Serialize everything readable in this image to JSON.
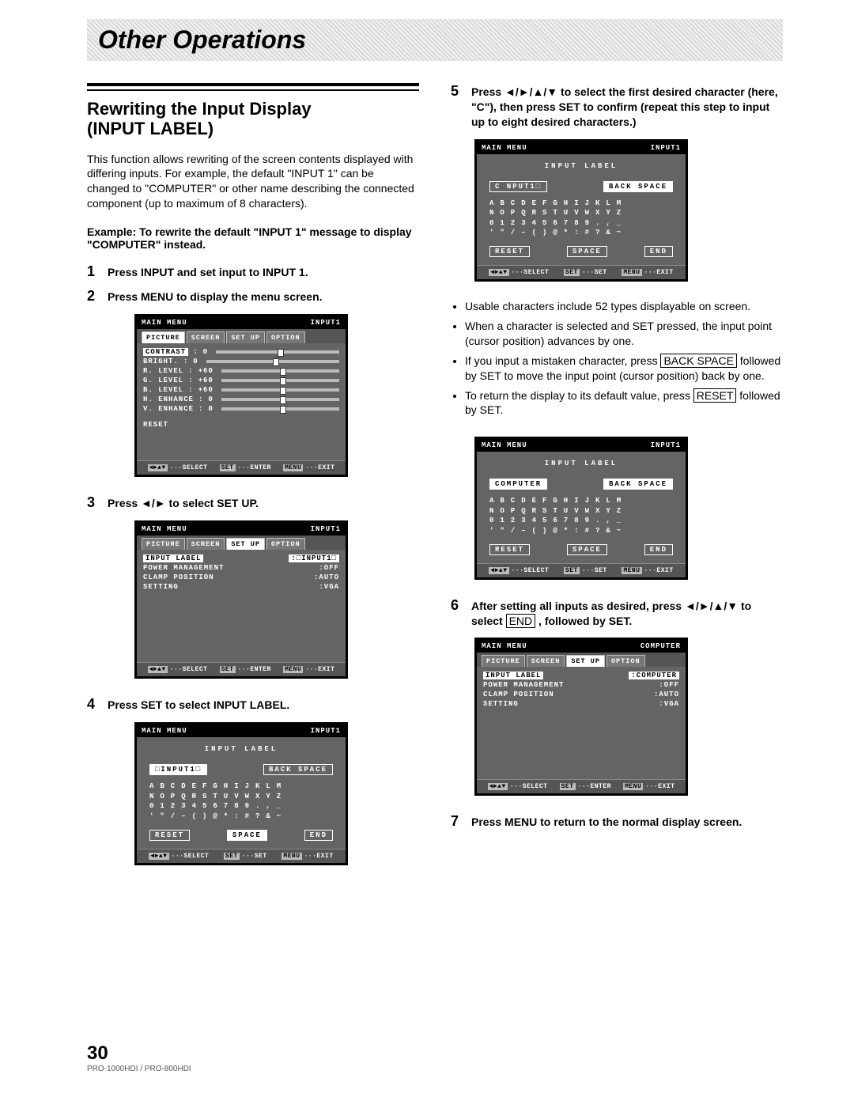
{
  "header": {
    "title": "Other Operations"
  },
  "glyphs": {
    "left": "◄",
    "right": "►",
    "up": "▲",
    "down": "▼"
  },
  "left": {
    "section_title_1": "Rewriting the Input Display",
    "section_title_2": "(INPUT LABEL)",
    "intro": "This function allows rewriting of the screen contents displayed with differing inputs. For example, the default \"INPUT 1\" can be changed to \"COMPUTER\" or other name describing the connected component (up to maximum of 8 characters).",
    "example": "Example: To rewrite the default \"INPUT 1\" message to display \"COMPUTER\" instead.",
    "steps": [
      {
        "num": "1",
        "text": "Press INPUT and set input to INPUT 1."
      },
      {
        "num": "2",
        "text": "Press MENU to display the menu screen."
      },
      {
        "num": "3",
        "pre": "Press ",
        "post": " to select SET UP."
      },
      {
        "num": "4",
        "text": "Press SET to select INPUT LABEL."
      }
    ]
  },
  "right": {
    "steps": [
      {
        "num": "5",
        "pre": "Press ",
        "post": " to select the first desired character (here, \"C\"), then press SET to confirm (repeat this step to input up to eight desired characters.)"
      },
      {
        "num": "6",
        "pre": "After setting all inputs as desired, press ",
        "mid": " to select ",
        "box": "END",
        "post": " , followed by SET."
      },
      {
        "num": "7",
        "text": "Press MENU to return to the normal display screen."
      }
    ],
    "notes": [
      "Usable characters include 52 types displayable on screen.",
      "When a character is selected and SET pressed, the input point (cursor position) advances by one.",
      {
        "pre": "If you input a mistaken character, press ",
        "box": "BACK SPACE",
        "post": " followed by SET to move the input point (cursor position) back by one."
      },
      {
        "pre": "To return the display to its default value, press ",
        "box": "RESET",
        "post": " followed by SET."
      }
    ]
  },
  "shots": {
    "tabs": [
      "PICTURE",
      "SCREEN",
      "SET UP",
      "OPTION"
    ],
    "foot": {
      "select": "···SELECT",
      "set": "SET",
      "enter": "···ENTER",
      "set2": "···SET",
      "menu": "MENU",
      "exit": "···EXIT"
    },
    "btns": {
      "backspace": "BACK SPACE",
      "reset": "RESET",
      "space": "SPACE",
      "end": "END"
    },
    "chars": [
      "ABCDEFGHIJKLM",
      "NOPQRSTUVWXYZ",
      "0123456789.,_",
      "'\"/–()@*:#?&~"
    ],
    "s1": {
      "title": "MAIN MENU",
      "input": "INPUT1",
      "items": [
        {
          "label": "CONTRAST",
          "val": "0"
        },
        {
          "label": "BRIGHT.",
          "val": "0"
        },
        {
          "label": "R. LEVEL",
          "val": "+60"
        },
        {
          "label": "G. LEVEL",
          "val": "+60"
        },
        {
          "label": "B. LEVEL",
          "val": "+60"
        },
        {
          "label": "H. ENHANCE",
          "val": "0"
        },
        {
          "label": "V. ENHANCE",
          "val": "0"
        }
      ],
      "reset": "RESET"
    },
    "s2": {
      "items": [
        {
          "label": "INPUT LABEL",
          "val": ":□INPUT1□"
        },
        {
          "label": "POWER MANAGEMENT",
          "val": ":OFF"
        },
        {
          "label": "CLAMP POSITION",
          "val": ":AUTO"
        },
        {
          "label": "SETTING",
          "val": ":VGA"
        }
      ]
    },
    "s3": {
      "subtitle": "INPUT LABEL",
      "current": "□INPUT1□"
    },
    "s4": {
      "current": "C NPUT1□"
    },
    "s5": {
      "current": "COMPUTER"
    },
    "s6": {
      "input": "COMPUTER",
      "val": ":COMPUTER"
    }
  },
  "footer": {
    "page_num": "30",
    "model": "PRO-1000HDI / PRO-800HDI"
  }
}
